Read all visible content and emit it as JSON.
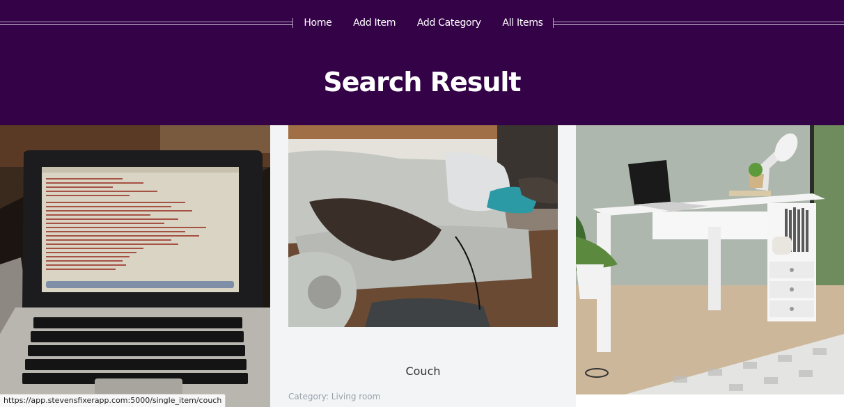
{
  "nav": {
    "items": [
      {
        "label": "Home"
      },
      {
        "label": "Add Item"
      },
      {
        "label": "Add Category"
      },
      {
        "label": "All Items"
      }
    ]
  },
  "page": {
    "title": "Search Result"
  },
  "results": [
    {
      "image": "laptop-photo"
    },
    {
      "image": "couch-photo",
      "name": "Couch",
      "category": "Category: Living room"
    },
    {
      "image": "desk-photo"
    }
  ],
  "status_bar": {
    "url": "https://app.stevensfixerapp.com:5000/single_item/couch"
  },
  "colors": {
    "header_bg": "#340247",
    "card_bg": "#f2f4f6"
  }
}
